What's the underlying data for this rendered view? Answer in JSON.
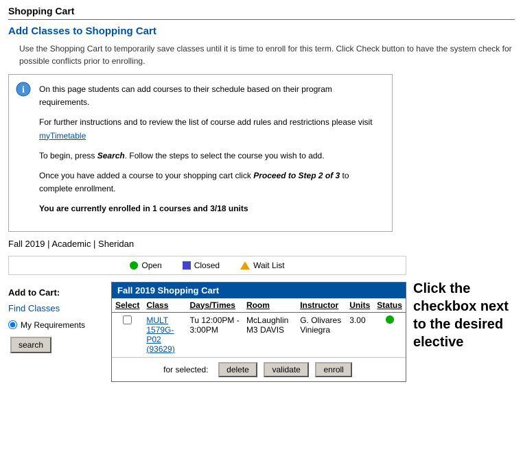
{
  "page": {
    "title": "Shopping Cart",
    "section_title": "Add Classes to Shopping Cart",
    "intro": "Use the Shopping Cart to temporarily save classes until it is time to enroll for this term.  Click Check button to have the system check for possible conflicts prior to enrolling.",
    "info_para1": "On this page students can add courses to their schedule based on their program requirements.",
    "info_para2_pre": "For further instructions and to review the list of course add rules and restrictions please visit ",
    "info_para2_link": "myTimetable",
    "info_para3_pre": "To begin, press ",
    "info_para3_bold_italic": "Search",
    "info_para3_post": ". Follow the steps to select the course you wish to add.",
    "info_para4_pre": "Once you have added a course to your shopping cart click ",
    "info_para4_bold_italic": "Proceed to Step 2 of 3",
    "info_para4_post": " to complete enrollment.",
    "info_enrolled": "You are currently enrolled in 1 courses and 3/18 units",
    "sidebar_text": "Click the checkbox next to the desired elective",
    "term_label": "Fall 2019 | Academic | Sheridan"
  },
  "legend": {
    "open_label": "Open",
    "closed_label": "Closed",
    "waitlist_label": "Wait List"
  },
  "left_panel": {
    "add_to_cart": "Add to Cart:",
    "find_classes": "Find Classes",
    "my_requirements": "My Requirements",
    "search_button": "search"
  },
  "cart": {
    "header": "Fall 2019 Shopping Cart",
    "columns": [
      "Select",
      "Class",
      "Days/Times",
      "Room",
      "Instructor",
      "Units",
      "Status"
    ],
    "rows": [
      {
        "class_name": "MULT 1579G-P02 (93629)",
        "days_times": "Tu 12:00PM - 3:00PM",
        "room": "McLaughlin M3 DAVIS",
        "instructor": "G. Olivares Viniegra",
        "units": "3.00",
        "status": "open"
      }
    ],
    "for_selected_label": "for selected:",
    "delete_btn": "delete",
    "validate_btn": "validate",
    "enroll_btn": "enroll"
  }
}
